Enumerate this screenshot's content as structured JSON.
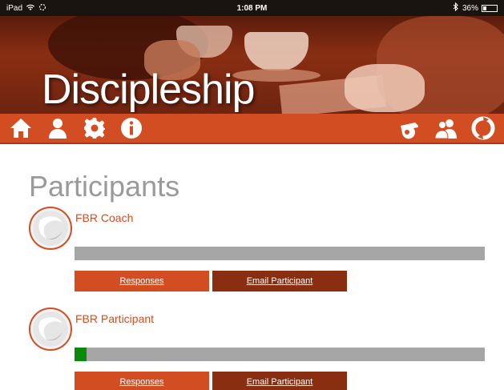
{
  "status_bar": {
    "device": "iPad",
    "time": "1:08 PM",
    "battery_text": "36%",
    "battery_level": 0.36
  },
  "hero": {
    "title": "Discipleship"
  },
  "nav": {
    "left_icons": [
      "home-icon",
      "user-icon",
      "gear-icon",
      "info-icon"
    ],
    "right_icons": [
      "whistle-icon",
      "group-icon",
      "refresh-icon"
    ]
  },
  "page": {
    "title": "Participants"
  },
  "participants": [
    {
      "name": "FBR Coach",
      "progress": 0.0,
      "responses_label": "Responses",
      "email_label": "Email Participant"
    },
    {
      "name": "FBR Participant",
      "progress": 0.03,
      "responses_label": "Responses",
      "email_label": "Email Participant"
    }
  ],
  "colors": {
    "accent": "#d34d23",
    "dark_accent": "#8a2e12",
    "progress_track": "#a6a6a6",
    "progress_fill": "#0a8a0a",
    "title_gray": "#9a9a9a"
  }
}
